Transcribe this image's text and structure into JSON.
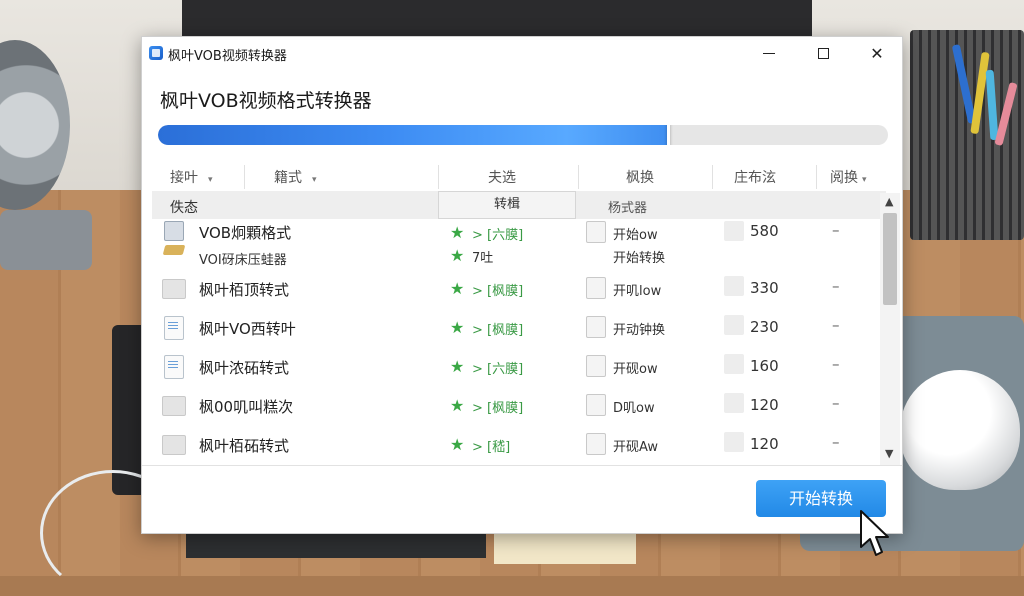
{
  "window": {
    "title": "枫叶VOB视频转换器",
    "minimize_icon": "minimize-icon",
    "maximize_icon": "maximize-icon",
    "close_icon": "close-icon",
    "close_glyph": "✕"
  },
  "heading": "枫叶VOB视频格式转换器",
  "progress": {
    "percent": 70
  },
  "columns": [
    {
      "label": "接叶",
      "sort": true
    },
    {
      "label": "籍式",
      "sort": true
    },
    {
      "label": "夫选",
      "sort": false
    },
    {
      "label": "枫换",
      "sort": false
    },
    {
      "label": "庄布泫",
      "sort": false
    },
    {
      "label": "阅换",
      "sort": true
    }
  ],
  "subheader": {
    "status_label": "佚态",
    "col_a": "转楫",
    "col_b": "杨式器"
  },
  "rows": [
    {
      "icon": "package-icon",
      "name": "VOB炯顆格式",
      "name2": "VOI砑床压蛙器",
      "status": "> [六膜]",
      "status2": "7吐",
      "conv": "开始ow",
      "conv2": "开始转换",
      "size": "580",
      "extra": "–"
    },
    {
      "icon": "folder-icon",
      "name": "枫叶栢顶转式",
      "status": "> [枫膜]",
      "conv": "开叽low",
      "size": "330",
      "extra": "–"
    },
    {
      "icon": "document-icon",
      "name": "枫叶VO西转叶",
      "status": "> [枫膜]",
      "conv": "开动钟换",
      "size": "230",
      "extra": "–"
    },
    {
      "icon": "document-icon",
      "name": "枫叶浓砳转式",
      "status": "> [六膜]",
      "conv": "开砚ow",
      "size": "160",
      "extra": "–"
    },
    {
      "icon": "folder-icon",
      "name": "枫00叽叫糕次",
      "status": "> [枫膜]",
      "conv": "D叽ow",
      "size": "120",
      "extra": "–"
    },
    {
      "icon": "folder-icon",
      "name": "枫叶栢砳转式",
      "status": "> [嵇]",
      "conv": "开砚Aw",
      "size": "120",
      "extra": "–"
    }
  ],
  "star_glyph": "★",
  "sort_glyph": "▾",
  "scroll_up_glyph": "▲",
  "scroll_down_glyph": "▼",
  "start_button": "开始转换",
  "colors": {
    "accent": "#2289e6",
    "status_green": "#3aa845"
  }
}
